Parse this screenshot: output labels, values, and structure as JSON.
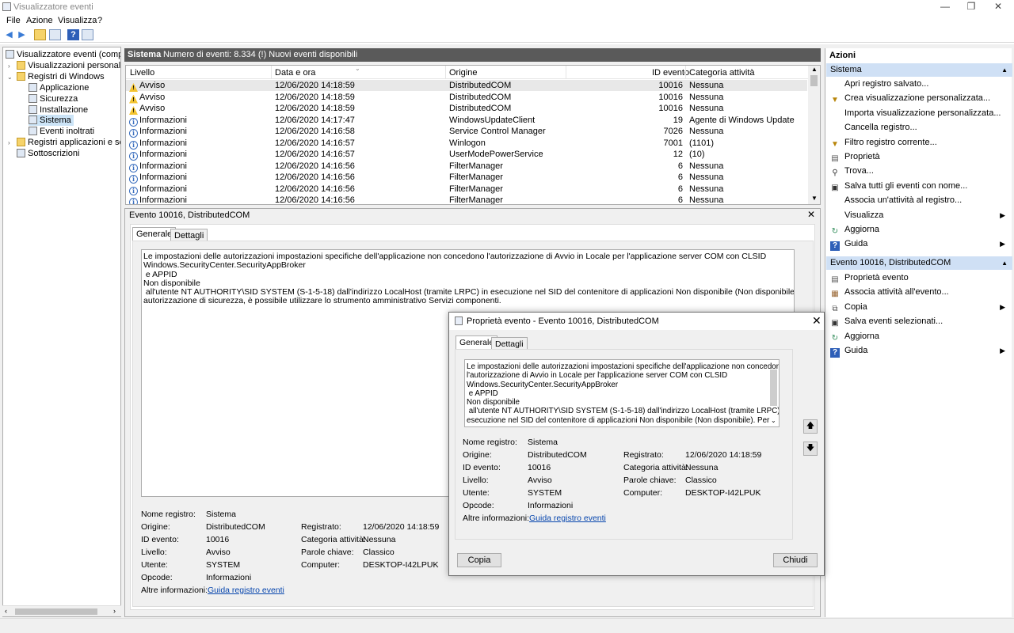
{
  "window": {
    "title": "Visualizzatore eventi",
    "minimize": "—",
    "maximize": "❐",
    "close": "✕"
  },
  "menu": [
    "File",
    "Azione",
    "Visualizza",
    "?"
  ],
  "tree": {
    "root": "Visualizzatore eventi (computer",
    "custom_views": "Visualizzazioni personalizzate",
    "windows_logs": "Registri di Windows",
    "logs": [
      "Applicazione",
      "Sicurezza",
      "Installazione",
      "Sistema",
      "Eventi inoltrati"
    ],
    "apps_logs": "Registri applicazioni e servizi",
    "subscriptions": "Sottoscrizioni"
  },
  "center": {
    "log_name": "Sistema",
    "count_text": "Numero di eventi: 8.334 (!) Nuovi eventi disponibili"
  },
  "table": {
    "headers": [
      "Livello",
      "Data e ora",
      "Origine",
      "ID evento",
      "Categoria attività"
    ],
    "rows": [
      {
        "level": "Avviso",
        "type": "warn",
        "date": "12/06/2020 14:18:59",
        "source": "DistributedCOM",
        "id": "10016",
        "cat": "Nessuna"
      },
      {
        "level": "Avviso",
        "type": "warn",
        "date": "12/06/2020 14:18:59",
        "source": "DistributedCOM",
        "id": "10016",
        "cat": "Nessuna"
      },
      {
        "level": "Avviso",
        "type": "warn",
        "date": "12/06/2020 14:18:59",
        "source": "DistributedCOM",
        "id": "10016",
        "cat": "Nessuna"
      },
      {
        "level": "Informazioni",
        "type": "info",
        "date": "12/06/2020 14:17:47",
        "source": "WindowsUpdateClient",
        "id": "19",
        "cat": "Agente di Windows Update"
      },
      {
        "level": "Informazioni",
        "type": "info",
        "date": "12/06/2020 14:16:58",
        "source": "Service Control Manager",
        "id": "7026",
        "cat": "Nessuna"
      },
      {
        "level": "Informazioni",
        "type": "info",
        "date": "12/06/2020 14:16:57",
        "source": "Winlogon",
        "id": "7001",
        "cat": "(1101)"
      },
      {
        "level": "Informazioni",
        "type": "info",
        "date": "12/06/2020 14:16:57",
        "source": "UserModePowerService",
        "id": "12",
        "cat": "(10)"
      },
      {
        "level": "Informazioni",
        "type": "info",
        "date": "12/06/2020 14:16:56",
        "source": "FilterManager",
        "id": "6",
        "cat": "Nessuna"
      },
      {
        "level": "Informazioni",
        "type": "info",
        "date": "12/06/2020 14:16:56",
        "source": "FilterManager",
        "id": "6",
        "cat": "Nessuna"
      },
      {
        "level": "Informazioni",
        "type": "info",
        "date": "12/06/2020 14:16:56",
        "source": "FilterManager",
        "id": "6",
        "cat": "Nessuna"
      },
      {
        "level": "Informazioni",
        "type": "info",
        "date": "12/06/2020 14:16:56",
        "source": "FilterManager",
        "id": "6",
        "cat": "Nessuna"
      }
    ]
  },
  "detail": {
    "title": "Evento 10016, DistributedCOM",
    "tabs": [
      "Generale",
      "Dettagli"
    ],
    "description": "Le impostazioni delle autorizzazioni impostazioni specifiche dell'applicazione non concedono l'autorizzazione di Avvio in Locale per l'applicazione server COM con CLSID\nWindows.SecurityCenter.SecurityAppBroker\n e APPID\nNon disponibile\n all'utente NT AUTHORITY\\SID SYSTEM (S-1-5-18) dall'indirizzo LocalHost (tramite LRPC) in esecuzione nel SID del contenitore di applicazioni Non disponibile (Non disponibile). Per modificare tale\nautorizzazione di sicurezza, è possibile utilizzare lo strumento amministrativo Servizi componenti.",
    "labels": {
      "log_name": "Nome registro:",
      "source": "Origine:",
      "event_id": "ID evento:",
      "level": "Livello:",
      "user": "Utente:",
      "opcode": "Opcode:",
      "more_info": "Altre informazioni:",
      "logged": "Registrato:",
      "task_category": "Categoria attività:",
      "keywords": "Parole chiave:",
      "computer": "Computer:"
    },
    "values": {
      "log_name": "Sistema",
      "source": "DistributedCOM",
      "event_id": "10016",
      "level": "Avviso",
      "user": "SYSTEM",
      "opcode": "Informazioni",
      "more_info": "Guida registro eventi",
      "logged": "12/06/2020 14:18:59",
      "task_category": "Nessuna",
      "keywords": "Classico",
      "computer": "DESKTOP-I42LPUK"
    }
  },
  "actions": {
    "header": "Azioni",
    "section1": "Sistema",
    "items1": [
      "Apri registro salvato...",
      "Crea visualizzazione personalizzata...",
      "Importa visualizzazione personalizzata...",
      "Cancella registro...",
      "Filtro registro corrente...",
      "Proprietà",
      "Trova...",
      "Salva tutti gli eventi con nome...",
      "Associa un'attività al registro...",
      "Visualizza",
      "Aggiorna",
      "Guida"
    ],
    "section2": "Evento 10016, DistributedCOM",
    "items2": [
      "Proprietà evento",
      "Associa attività all'evento...",
      "Copia",
      "Salva eventi selezionati...",
      "Aggiorna",
      "Guida"
    ]
  },
  "dialog": {
    "title": "Proprietà evento - Evento 10016, DistributedCOM",
    "tabs": [
      "Generale",
      "Dettagli"
    ],
    "description": "Le impostazioni delle autorizzazioni impostazioni specifiche dell'applicazione non concedono\nl'autorizzazione di Avvio in Locale per l'applicazione server COM con CLSID\nWindows.SecurityCenter.SecurityAppBroker\n e APPID\nNon disponibile\n all'utente NT AUTHORITY\\SID SYSTEM (S-1-5-18) dall'indirizzo LocalHost (tramite LRPC) in\nesecuzione nel SID del contenitore di applicazioni Non disponibile (Non disponibile). Per",
    "copy": "Copia",
    "close": "Chiudi"
  }
}
